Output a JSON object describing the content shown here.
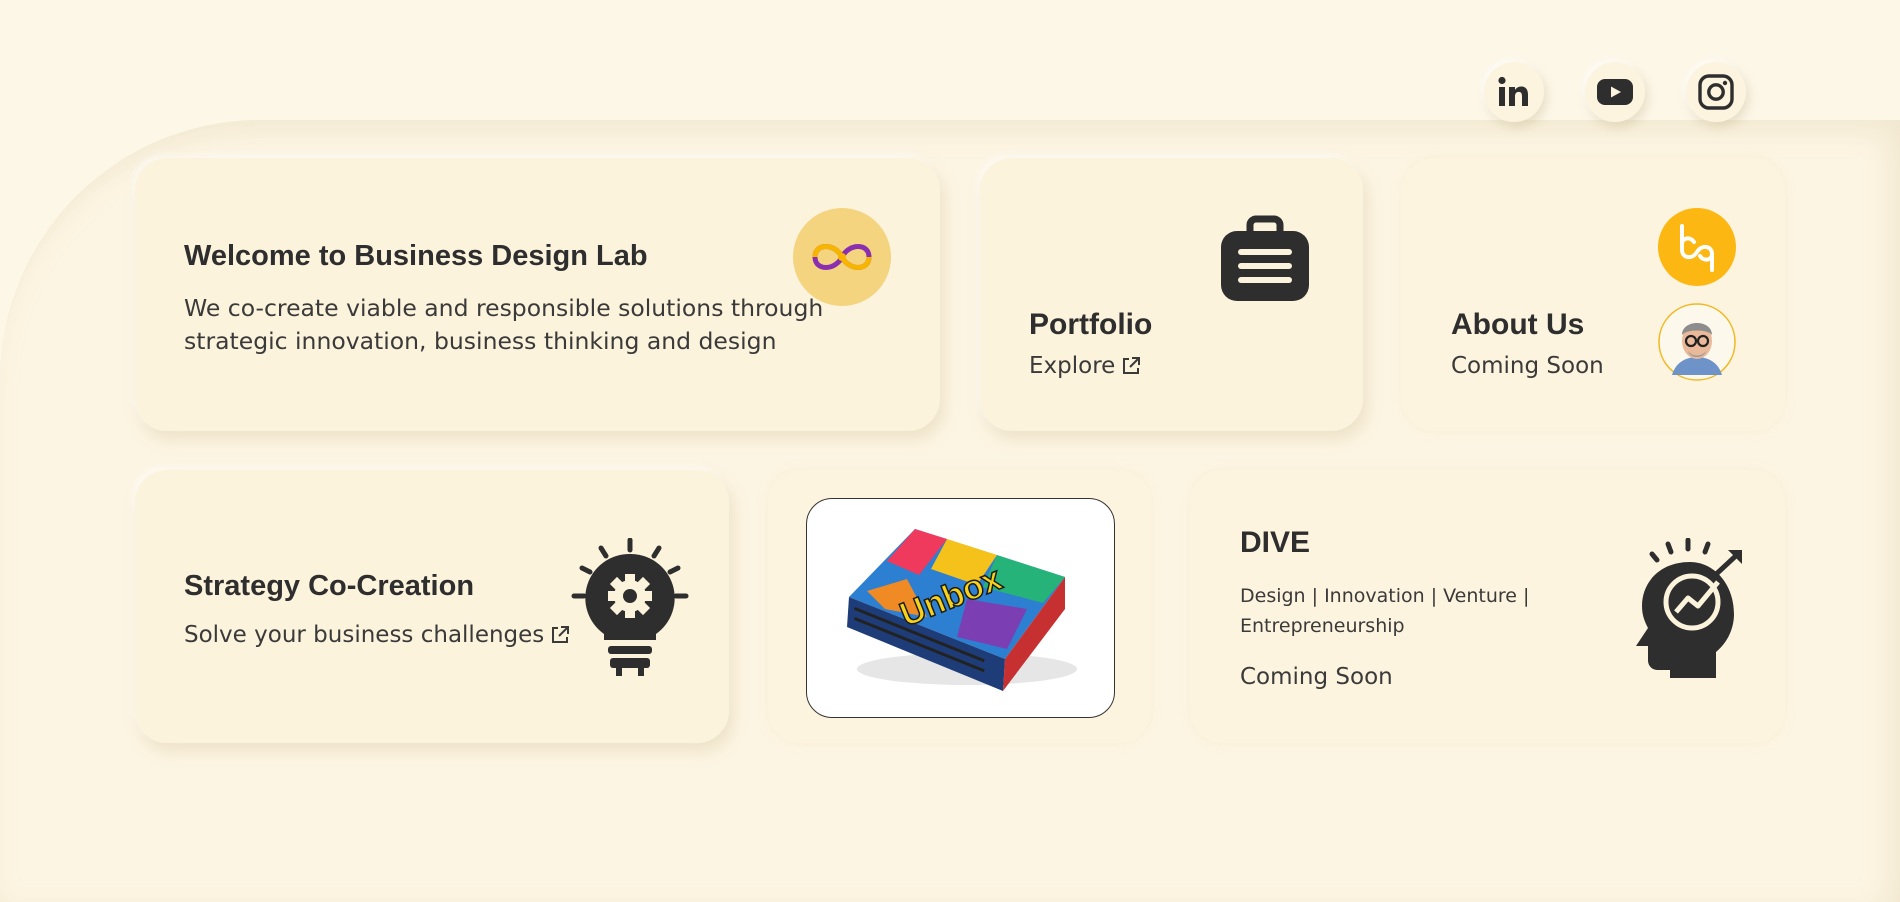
{
  "colors": {
    "background": "#fdf7e8",
    "card": "#fcf3dc",
    "accent": "#fcb713",
    "icon_dark": "#2e2e2e"
  },
  "social": [
    {
      "name": "linkedin-icon"
    },
    {
      "name": "youtube-icon"
    },
    {
      "name": "instagram-icon"
    }
  ],
  "welcome": {
    "title": "Welcome to Business Design Lab",
    "description_line1": "We co-create viable and responsible solutions through",
    "description_line2": "strategic innovation, business thinking and design",
    "icon": "infinity-logo-icon"
  },
  "portfolio": {
    "title": "Portfolio",
    "link": "Explore",
    "icon": "briefcase-icon"
  },
  "about": {
    "title": "About Us",
    "status": "Coming Soon",
    "icons": [
      "bdl-logo-icon",
      "avatar"
    ]
  },
  "strategy": {
    "title": "Strategy Co-Creation",
    "link": "Solve your business challenges",
    "icon": "bulb-gear-icon"
  },
  "product": {
    "box_text": "Unbox"
  },
  "dive": {
    "title": "DIVE",
    "tags_line1": "Design | Innovation | Venture |",
    "tags_line2": "Entrepreneurship",
    "status": "Coming Soon",
    "icon": "head-growth-icon"
  }
}
